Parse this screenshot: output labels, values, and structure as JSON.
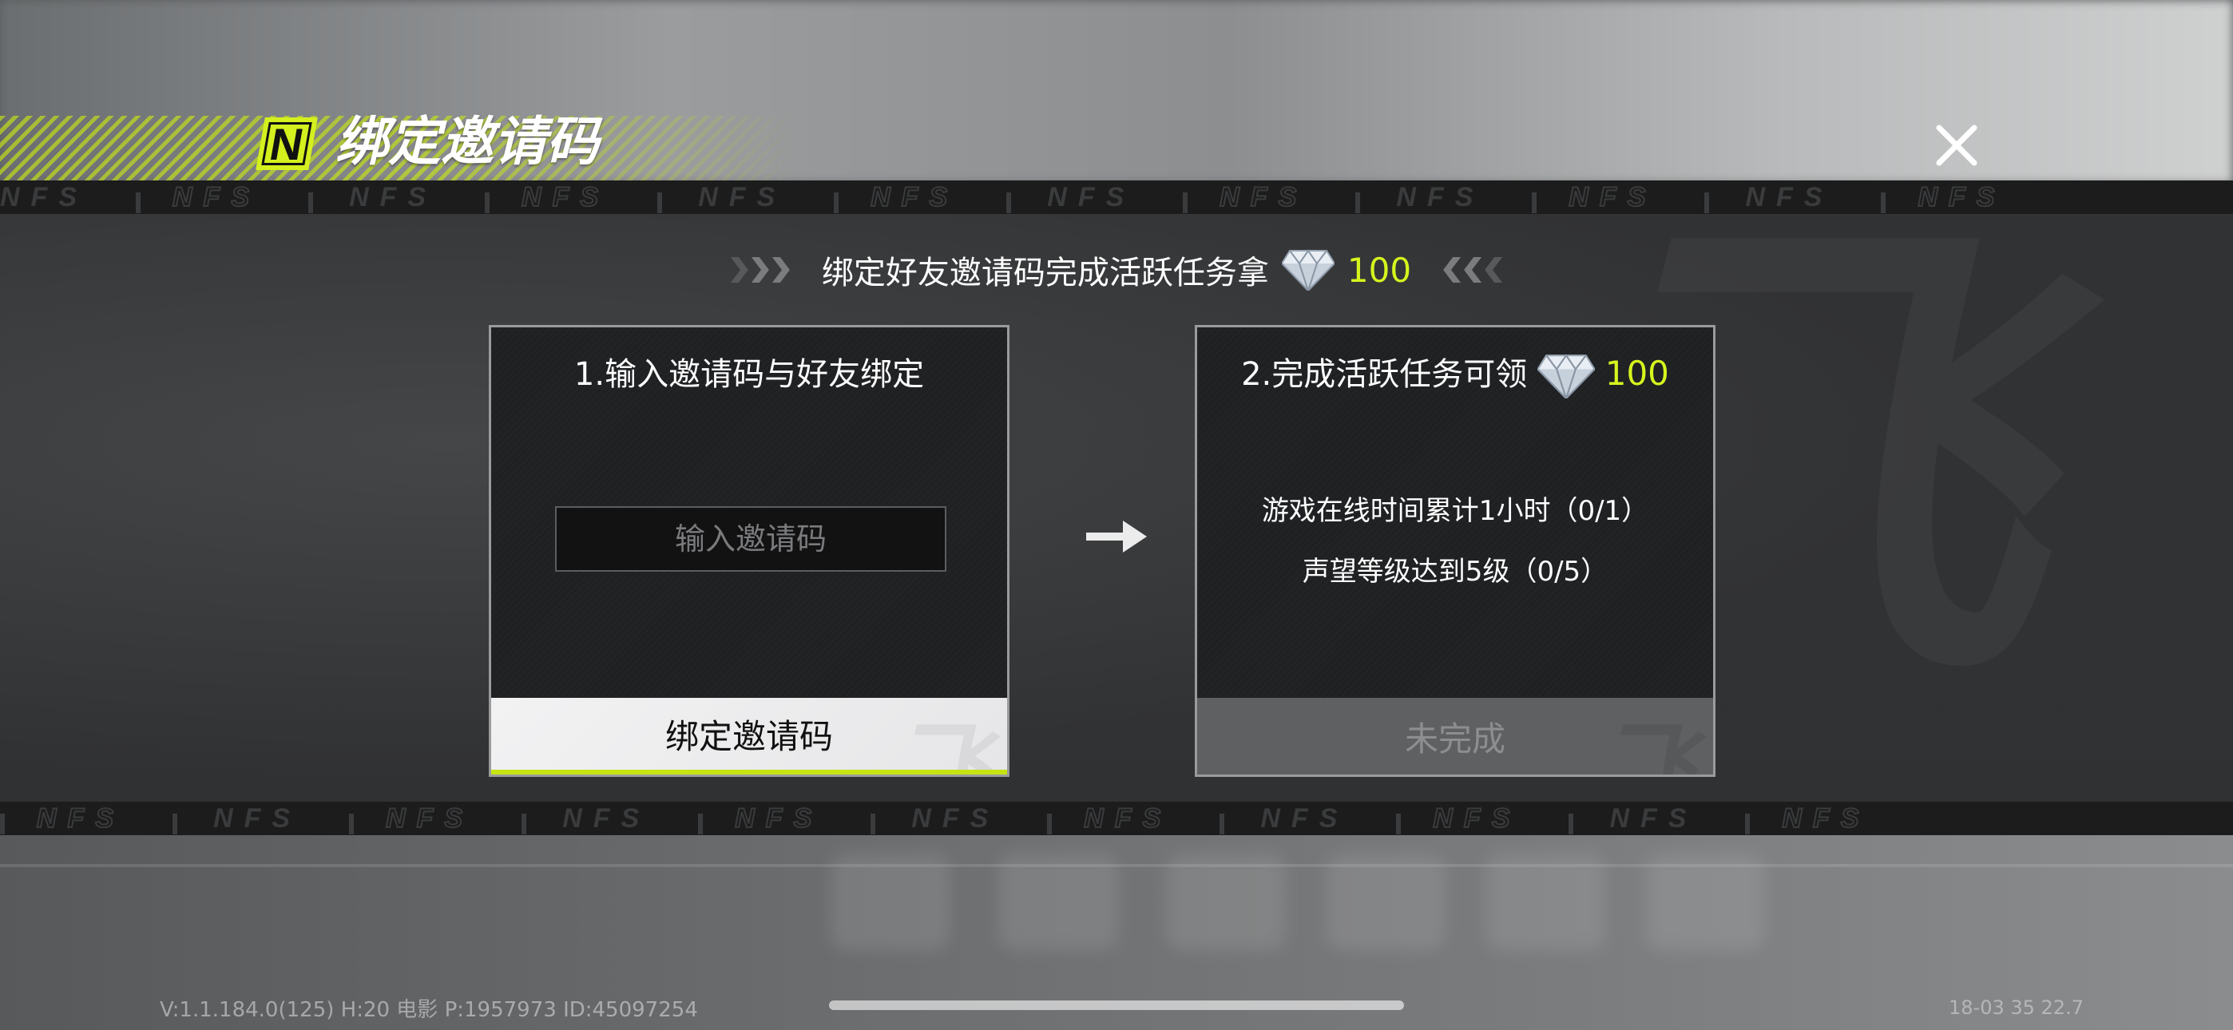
{
  "header": {
    "logo_letter": "N",
    "title": "绑定邀请码",
    "close_icon": "close-icon"
  },
  "strip_text": "NFS",
  "reward": {
    "text": "绑定好友邀请码完成活跃任务拿",
    "gem_icon": "diamond-icon",
    "amount": "100"
  },
  "step1": {
    "title": "1.输入邀请码与好友绑定",
    "input_placeholder": "输入邀请码",
    "input_value": "",
    "button_label": "绑定邀请码"
  },
  "step2": {
    "title": "2.完成活跃任务可领",
    "amount": "100",
    "tasks": [
      "游戏在线时间累计1小时（0/1）",
      "声望等级达到5级（0/5）"
    ],
    "status_label": "未完成"
  },
  "footer": {
    "version_info": "V:1.1.184.0(125) H:20 电影 P:1957973 ID:45097254",
    "right_info": "18-03 35 22.7"
  },
  "colors": {
    "accent": "#d6f51e",
    "panel": "#323335",
    "strip": "#1c1c1d"
  }
}
